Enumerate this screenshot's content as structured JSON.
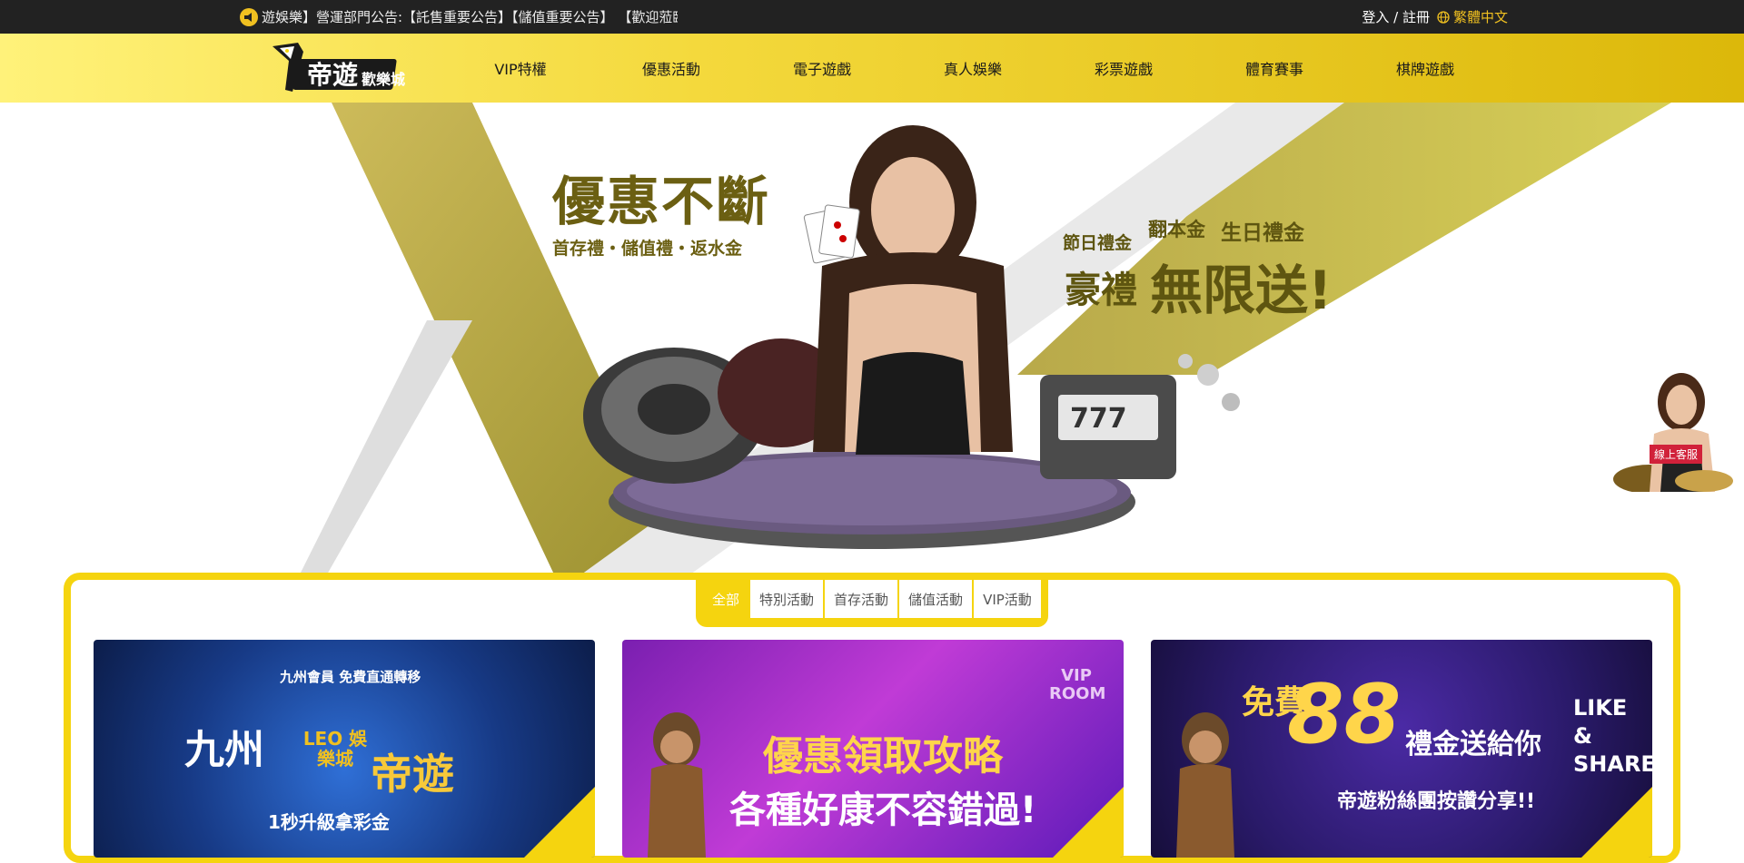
{
  "topbar": {
    "announcement": "遊娛樂】營運部門公告:【託售重要公告】【儲值重要公告】 【歡迎蒞臨",
    "auth_label": "登入 / 註冊",
    "language_label": "繁體中文",
    "icon": "megaphone-icon"
  },
  "header": {
    "logo_text": "帝遊",
    "logo_subtext": "歡樂城",
    "nav": [
      {
        "label": "VIP特權"
      },
      {
        "label": "優惠活動"
      },
      {
        "label": "電子遊戲"
      },
      {
        "label": "真人娛樂"
      },
      {
        "label": "彩票遊戲"
      },
      {
        "label": "體育賽事"
      },
      {
        "label": "棋牌遊戲"
      }
    ]
  },
  "banner": {
    "left_headline": "優惠不斷",
    "left_sub": "首存禮・儲值禮・返水金",
    "right_line1": "節日禮金",
    "right_line2": "翻本金",
    "right_line3": "生日禮金",
    "right_line4": "豪禮",
    "right_line5": "無限送!"
  },
  "customer_service": {
    "label": "線上客服"
  },
  "promotions": {
    "tabs": [
      {
        "label": "全部",
        "active": true
      },
      {
        "label": "特別活動",
        "active": false
      },
      {
        "label": "首存活動",
        "active": false
      },
      {
        "label": "儲值活動",
        "active": false
      },
      {
        "label": "VIP活動",
        "active": false
      }
    ],
    "cards": [
      {
        "line1": "九州",
        "line2": "帝遊",
        "line3": "LEO 娛樂城",
        "line4": "1秒升級拿彩金",
        "line5": "九州會員 免費直通轉移"
      },
      {
        "line1": "優惠領取攻略",
        "line2": "各種好康不容錯過!",
        "line3": "VIP ROOM"
      },
      {
        "line1": "免費",
        "line2": "88",
        "line3": "禮金送給你",
        "line4": "帝遊粉絲團按讚分享!!",
        "line5": "LIKE & SHARE"
      }
    ]
  },
  "colors": {
    "accent": "#f5d40f",
    "topbar_bg": "#222222",
    "promo_text": "#6b5f12",
    "cs_badge": "#d1213a"
  }
}
